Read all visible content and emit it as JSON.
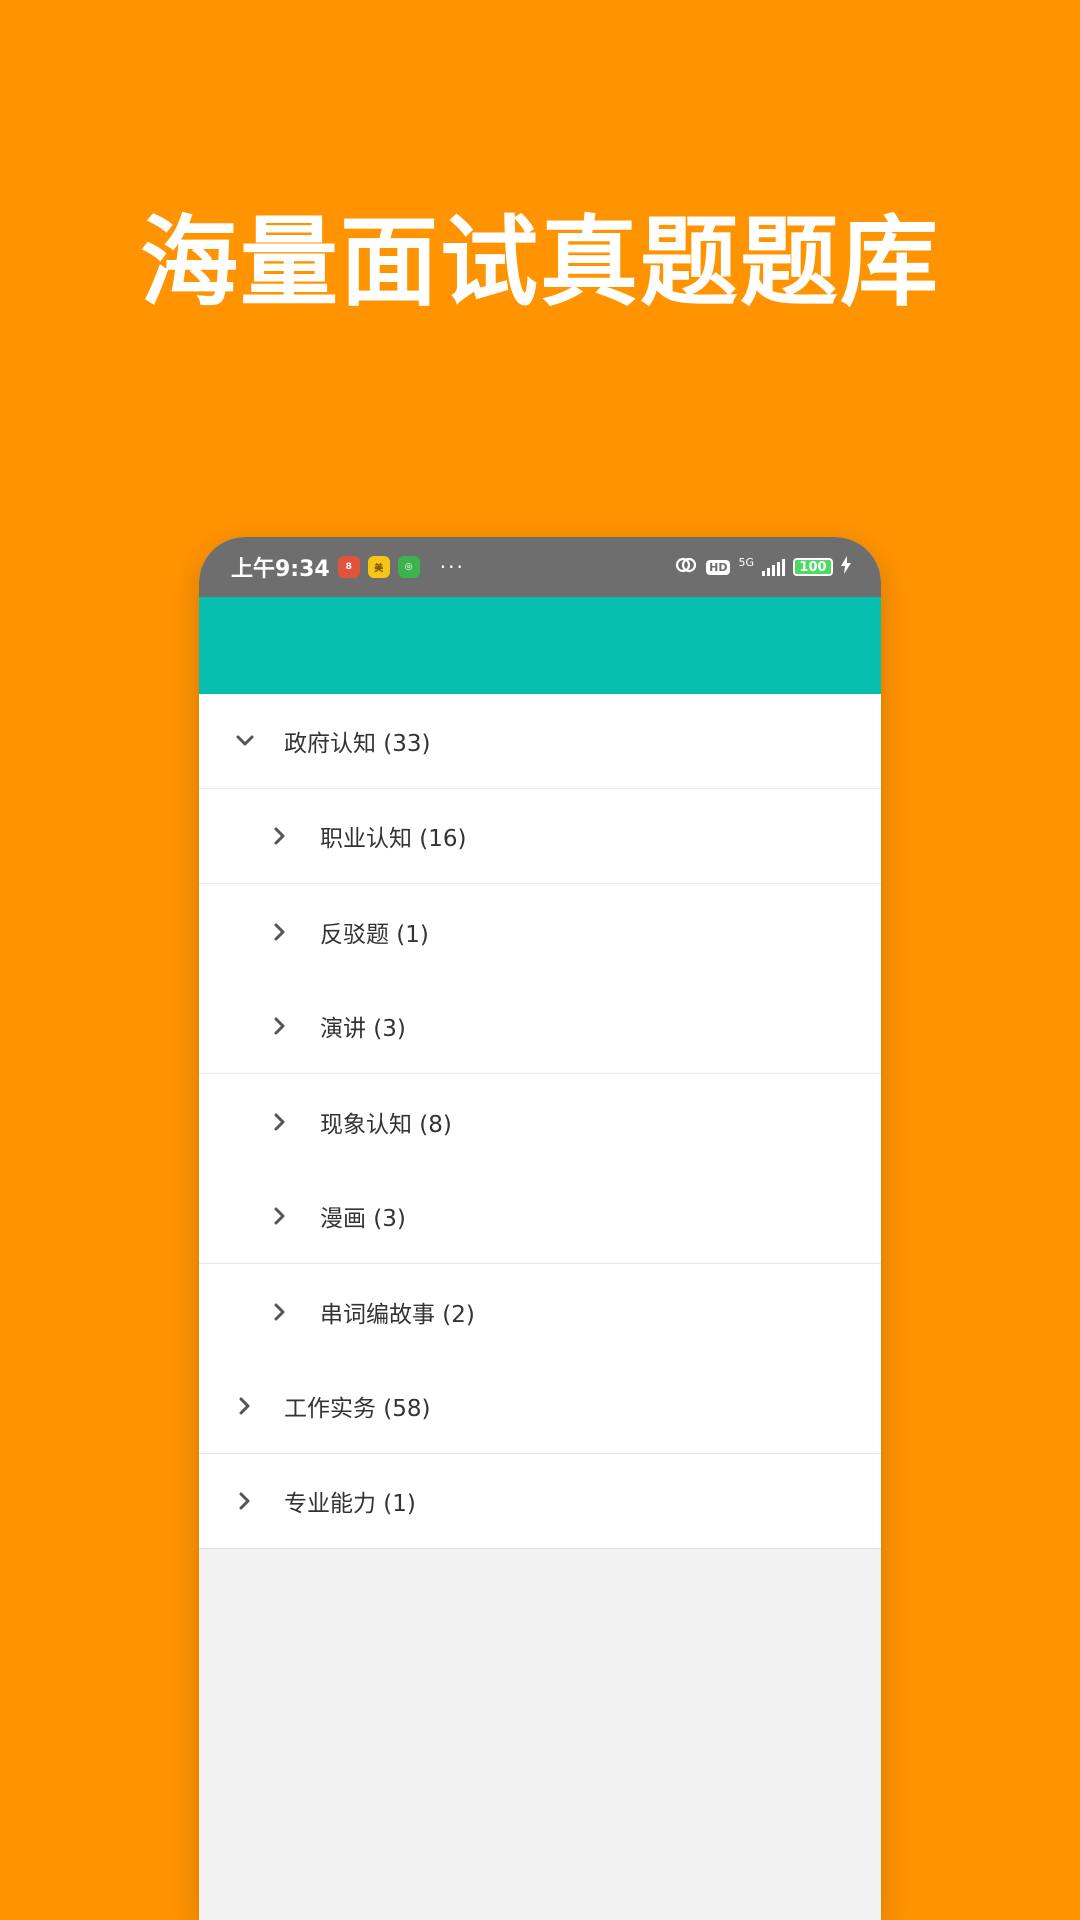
{
  "headline": "海量面试真题题库",
  "status_bar": {
    "time": "上午9:34",
    "notification_icons": [
      {
        "name": "app-notification-icon-red",
        "color": "#E2533C",
        "glyph": "8"
      },
      {
        "name": "app-notification-icon-yellow",
        "color": "#F5C518",
        "glyph": "美"
      },
      {
        "name": "app-notification-icon-green",
        "color": "#3CB44B",
        "glyph": "◎"
      }
    ],
    "more": "···",
    "network": "5G",
    "hd": "HD",
    "battery": "100"
  },
  "colors": {
    "background": "#FF9300",
    "appbar": "#07BFAE",
    "statusbar": "#6E6E6E"
  },
  "tree": [
    {
      "label": "政府认知 (33)",
      "level": 0,
      "expanded": true
    },
    {
      "label": "职业认知 (16)",
      "level": 1,
      "expanded": false
    },
    {
      "label": "反驳题 (1)",
      "level": 1,
      "expanded": false
    },
    {
      "label": "演讲 (3)",
      "level": 1,
      "expanded": false
    },
    {
      "label": "现象认知 (8)",
      "level": 1,
      "expanded": false
    },
    {
      "label": "漫画 (3)",
      "level": 1,
      "expanded": false
    },
    {
      "label": "串词编故事 (2)",
      "level": 1,
      "expanded": false
    },
    {
      "label": "工作实务 (58)",
      "level": 0,
      "expanded": false
    },
    {
      "label": "专业能力 (1)",
      "level": 0,
      "expanded": false
    }
  ]
}
